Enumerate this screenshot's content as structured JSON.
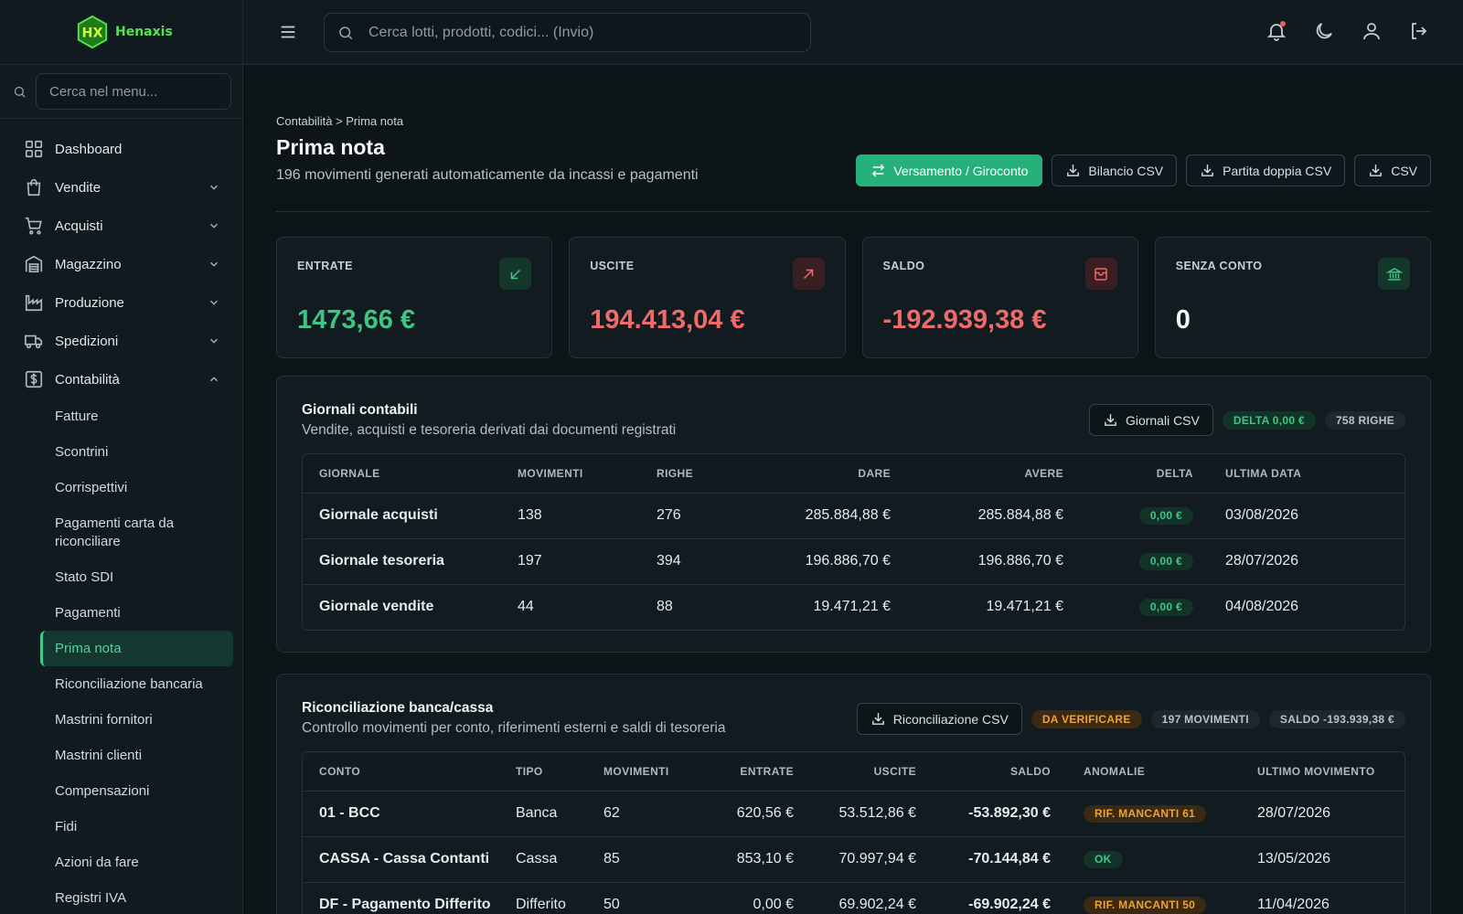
{
  "app": {
    "logo_text": "Henaxis",
    "logo_monogram": "HX",
    "brand_color": "#54e34a",
    "accent": "#27b17a"
  },
  "topbar": {
    "search_placeholder": "Cerca lotti, prodotti, codici... (Invio)"
  },
  "sidebar": {
    "search_placeholder": "Cerca nel menu...",
    "items": [
      {
        "label": "Dashboard",
        "icon": "dashboard-icon"
      },
      {
        "label": "Vendite",
        "icon": "shopping-bag-icon"
      },
      {
        "label": "Acquisti",
        "icon": "cart-icon"
      },
      {
        "label": "Magazzino",
        "icon": "warehouse-icon"
      },
      {
        "label": "Produzione",
        "icon": "factory-icon"
      },
      {
        "label": "Spedizioni",
        "icon": "truck-icon"
      },
      {
        "label": "Contabilità",
        "icon": "dollar-icon"
      }
    ],
    "sub_items": [
      "Fatture",
      "Scontrini",
      "Corrispettivi",
      "Pagamenti carta da riconciliare",
      "Stato SDI",
      "Pagamenti",
      "Prima nota",
      "Riconciliazione bancaria",
      "Mastrini fornitori",
      "Mastrini clienti",
      "Compensazioni",
      "Fidi",
      "Azioni da fare",
      "Registri IVA"
    ]
  },
  "page": {
    "breadcrumb": "Contabilità > Prima nota",
    "title": "Prima nota",
    "subtitle": "196 movimenti generati automaticamente da incassi e pagamenti",
    "actions": {
      "primary": "Versamento / Giroconto",
      "bilancio": "Bilancio CSV",
      "partita": "Partita doppia CSV",
      "csv": "CSV"
    }
  },
  "cards": [
    {
      "label": "ENTRATE",
      "value": "1473,66 €",
      "color": "#3fc483",
      "icon": "arrow-down-left-icon"
    },
    {
      "label": "USCITE",
      "value": "194.413,04 €",
      "color": "#ef6b6b",
      "icon": "arrow-up-right-icon"
    },
    {
      "label": "SALDO",
      "value": "-192.939,38 €",
      "color": "#ef6b6b",
      "icon": "wallet-icon"
    },
    {
      "label": "SENZA CONTO",
      "value": "0",
      "color": "#f4f7f8",
      "icon": "bank-icon"
    }
  ],
  "journals": {
    "title": "Giornali contabili",
    "subtitle": "Vendite, acquisti e tesoreria derivati dai documenti registrati",
    "export_label": "Giornali CSV",
    "badge_delta": "DELTA 0,00 €",
    "badge_rows": "758 RIGHE",
    "columns": [
      "GIORNALE",
      "MOVIMENTI",
      "RIGHE",
      "DARE",
      "AVERE",
      "DELTA",
      "ULTIMA DATA"
    ],
    "rows": [
      {
        "name": "Giornale acquisti",
        "movimenti": "138",
        "righe": "276",
        "dare": "285.884,88 €",
        "avere": "285.884,88 €",
        "delta": "0,00 €",
        "data": "03/08/2026"
      },
      {
        "name": "Giornale tesoreria",
        "movimenti": "197",
        "righe": "394",
        "dare": "196.886,70 €",
        "avere": "196.886,70 €",
        "delta": "0,00 €",
        "data": "28/07/2026"
      },
      {
        "name": "Giornale vendite",
        "movimenti": "44",
        "righe": "88",
        "dare": "19.471,21 €",
        "avere": "19.471,21 €",
        "delta": "0,00 €",
        "data": "04/08/2026"
      }
    ]
  },
  "reconciliation": {
    "title": "Riconciliazione banca/cassa",
    "subtitle": "Controllo movimenti per conto, riferimenti esterni e saldi di tesoreria",
    "export_label": "Riconciliazione CSV",
    "badge_status": "DA VERIFICARE",
    "badge_moves": "197 MOVIMENTI",
    "badge_saldo": "SALDO -193.939,38 €",
    "columns": [
      "CONTO",
      "TIPO",
      "MOVIMENTI",
      "ENTRATE",
      "USCITE",
      "SALDO",
      "ANOMALIE",
      "ULTIMO MOVIMENTO"
    ],
    "rows": [
      {
        "conto": "01 - BCC",
        "tipo": "Banca",
        "movimenti": "62",
        "entrate": "620,56 €",
        "uscite": "53.512,86 €",
        "saldo": "-53.892,30 €",
        "anomalie": "RIF. MANCANTI 61",
        "anomalie_type": "orange",
        "ultimo": "28/07/2026"
      },
      {
        "conto": "CASSA - Cassa Contanti",
        "tipo": "Cassa",
        "movimenti": "85",
        "entrate": "853,10 €",
        "uscite": "70.997,94 €",
        "saldo": "-70.144,84 €",
        "anomalie": "OK",
        "anomalie_type": "green",
        "ultimo": "13/05/2026"
      },
      {
        "conto": "DF - Pagamento Differito",
        "tipo": "Differito",
        "movimenti": "50",
        "entrate": "0,00 €",
        "uscite": "69.902,24 €",
        "saldo": "-69.902,24 €",
        "anomalie": "RIF. MANCANTI 50",
        "anomalie_type": "orange",
        "ultimo": "11/04/2026"
      }
    ]
  }
}
